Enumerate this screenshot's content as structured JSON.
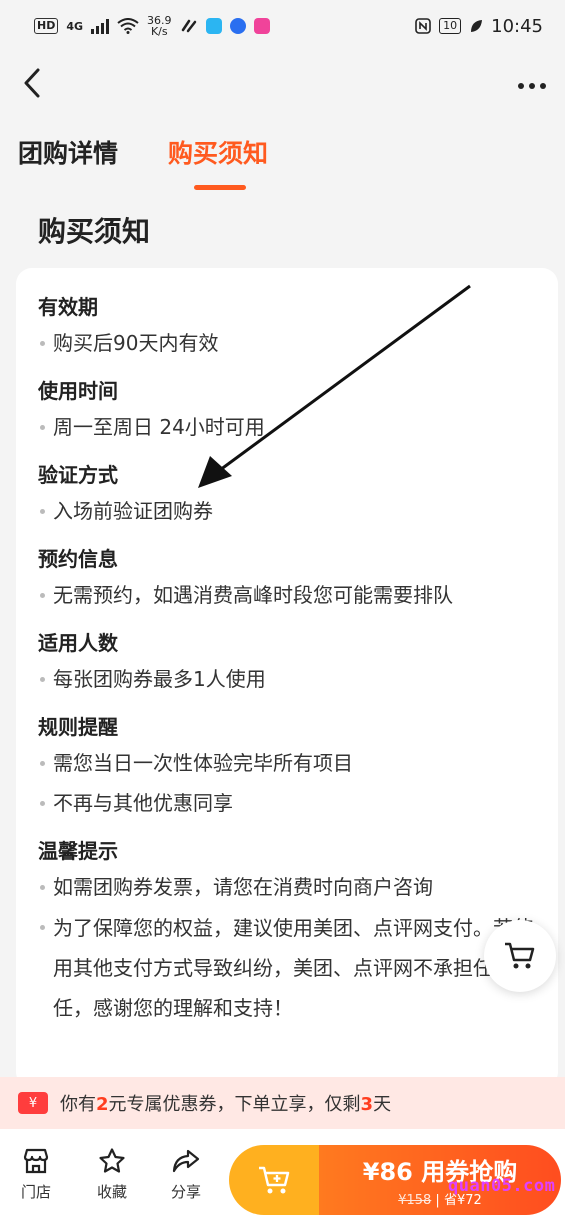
{
  "status_bar": {
    "hd": "HD",
    "network": "4G",
    "speed_value": "36.9",
    "speed_unit": "K/s",
    "battery": "10",
    "time": "10:45"
  },
  "tabs": [
    {
      "label": "团购详情",
      "active": false
    },
    {
      "label": "购买须知",
      "active": true
    }
  ],
  "section_title": "购买须知",
  "notice": [
    {
      "title": "有效期",
      "items": [
        "购买后90天内有效"
      ]
    },
    {
      "title": "使用时间",
      "items": [
        "周一至周日 24小时可用"
      ]
    },
    {
      "title": "验证方式",
      "items": [
        "入场前验证团购券"
      ]
    },
    {
      "title": "预约信息",
      "items": [
        "无需预约，如遇消费高峰时段您可能需要排队"
      ]
    },
    {
      "title": "适用人数",
      "items": [
        "每张团购券最多1人使用"
      ]
    },
    {
      "title": "规则提醒",
      "items": [
        "需您当日一次性体验完毕所有项目",
        "不再与其他优惠同享"
      ]
    },
    {
      "title": "温馨提示",
      "items": [
        "如需团购券发票，请您在消费时向商户咨询",
        "为了保障您的权益，建议使用美团、点评网支付。若使用其他支付方式导致纠纷，美团、点评网不承担任何责任，感谢您的理解和支持！"
      ]
    }
  ],
  "coupon": {
    "icon": "¥",
    "prefix": "你有",
    "amount": "2",
    "middle": "元专属优惠券，下单立享，仅剩",
    "days": "3",
    "suffix": "天"
  },
  "bottom_nav": {
    "store": "门店",
    "favorite": "收藏",
    "share": "分享"
  },
  "buy": {
    "price_label": "¥86 用券抢购",
    "original_price": "¥158",
    "discount_label": "省¥72"
  },
  "watermark": "quan05.com",
  "colors": {
    "accent": "#ff5a1f",
    "buy_left": "#ffb01f",
    "coupon_bg": "#ffe8e4"
  }
}
